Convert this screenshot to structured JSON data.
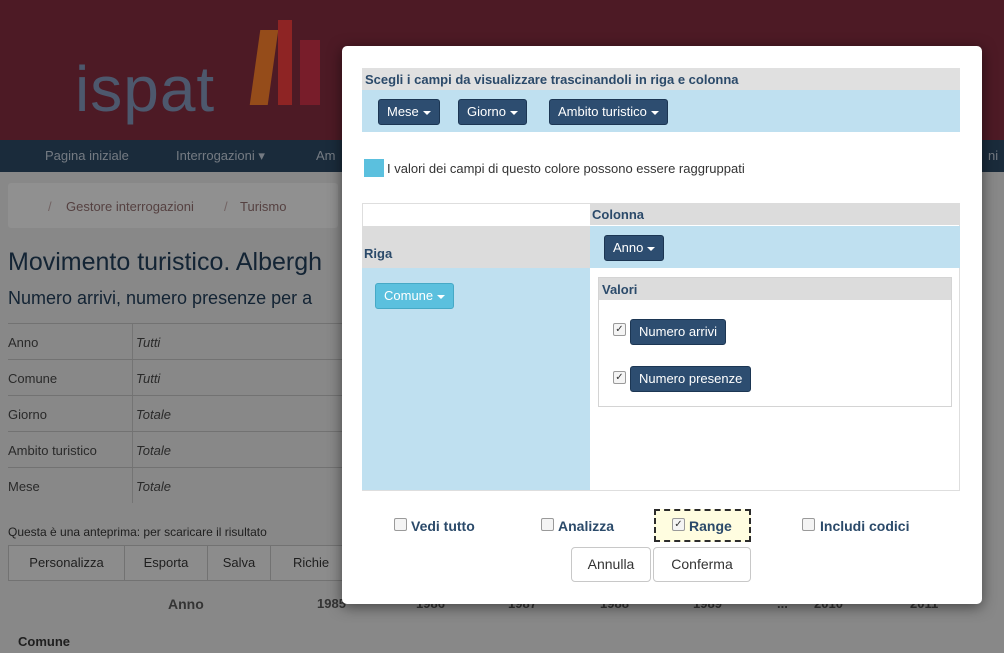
{
  "background": {
    "logo_text": "ispat",
    "nav": [
      "Pagina iniziale",
      "Interrogazioni",
      "Am",
      "ni"
    ],
    "breadcrumb": [
      "Gestore interrogazioni",
      "Turismo"
    ],
    "page_title": "Movimento turistico. Albergh",
    "page_subtitle": "Numero arrivi, numero presenze per a",
    "filters": [
      {
        "key": "Anno",
        "value": "Tutti"
      },
      {
        "key": "Comune",
        "value": "Tutti"
      },
      {
        "key": "Giorno",
        "value": "Totale"
      },
      {
        "key": "Ambito turistico",
        "value": "Totale"
      },
      {
        "key": "Mese",
        "value": "Totale"
      }
    ],
    "preview_text": "Questa è una anteprima: per scaricare il risultato",
    "tabs": [
      "Personalizza",
      "Esporta",
      "Salva",
      "Richie"
    ],
    "table": {
      "anno_label": "Anno",
      "years": [
        "1985",
        "1986",
        "1987",
        "1988",
        "1989",
        "...",
        "2010",
        "2011"
      ],
      "row_label": "Comune"
    }
  },
  "modal": {
    "header": "Scegli i campi da visualizzare trascinandoli in riga e colonna",
    "available_fields": [
      "Mese",
      "Giorno",
      "Ambito turistico"
    ],
    "legend_text": "I valori dei campi di questo colore possono essere raggruppati",
    "column_label": "Colonna",
    "column_fields": [
      "Anno"
    ],
    "row_label": "Riga",
    "row_fields": [
      "Comune"
    ],
    "values_label": "Valori",
    "values": [
      {
        "label": "Numero arrivi",
        "checked": true
      },
      {
        "label": "Numero presenze",
        "checked": true
      }
    ],
    "options": [
      {
        "label": "Vedi tutto",
        "checked": false
      },
      {
        "label": "Analizza",
        "checked": false
      },
      {
        "label": "Range",
        "checked": true
      },
      {
        "label": "Includi codici",
        "checked": false
      }
    ],
    "buttons": {
      "cancel": "Annulla",
      "confirm": "Conferma"
    }
  }
}
